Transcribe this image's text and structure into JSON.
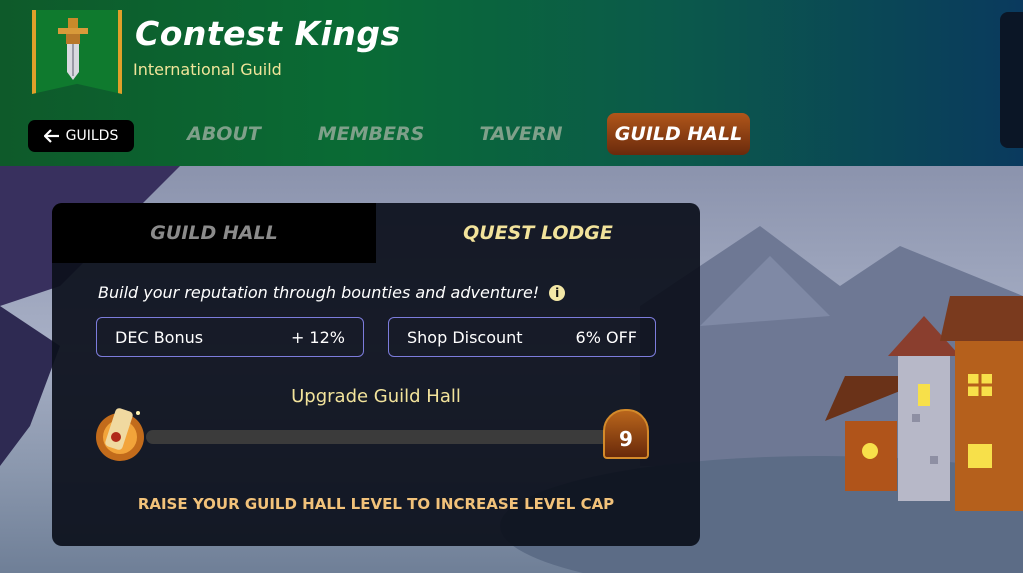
{
  "header": {
    "guild_name": "Contest Kings",
    "guild_type": "International Guild",
    "back_label": "GUILDS"
  },
  "nav": {
    "tabs": [
      {
        "label": "ABOUT",
        "active": false
      },
      {
        "label": "MEMBERS",
        "active": false
      },
      {
        "label": "TAVERN",
        "active": false
      },
      {
        "label": "GUILD HALL",
        "active": true
      }
    ]
  },
  "panel": {
    "tabs": [
      {
        "label": "GUILD HALL",
        "active": false
      },
      {
        "label": "QUEST LODGE",
        "active": true
      }
    ],
    "tagline": "Build your reputation through bounties and adventure!",
    "info_icon": "i",
    "stats": [
      {
        "label": "DEC Bonus",
        "value": "+ 12%"
      },
      {
        "label": "Shop Discount",
        "value": "6% OFF"
      }
    ],
    "upgrade_label": "Upgrade Guild Hall",
    "progress_fraction": 0,
    "level": "9",
    "raise_note": "RAISE YOUR GUILD HALL LEVEL TO INCREASE LEVEL CAP"
  },
  "icons": {
    "banner": "sword-banner-icon",
    "back": "arrow-left-icon",
    "info": "info-icon",
    "scroll": "scroll-icon"
  },
  "colors": {
    "header_green": "#0a6b35",
    "active_tab": "#8a3a10",
    "accent_yellow": "#f2e39b",
    "stat_border": "#7c7cdc"
  }
}
